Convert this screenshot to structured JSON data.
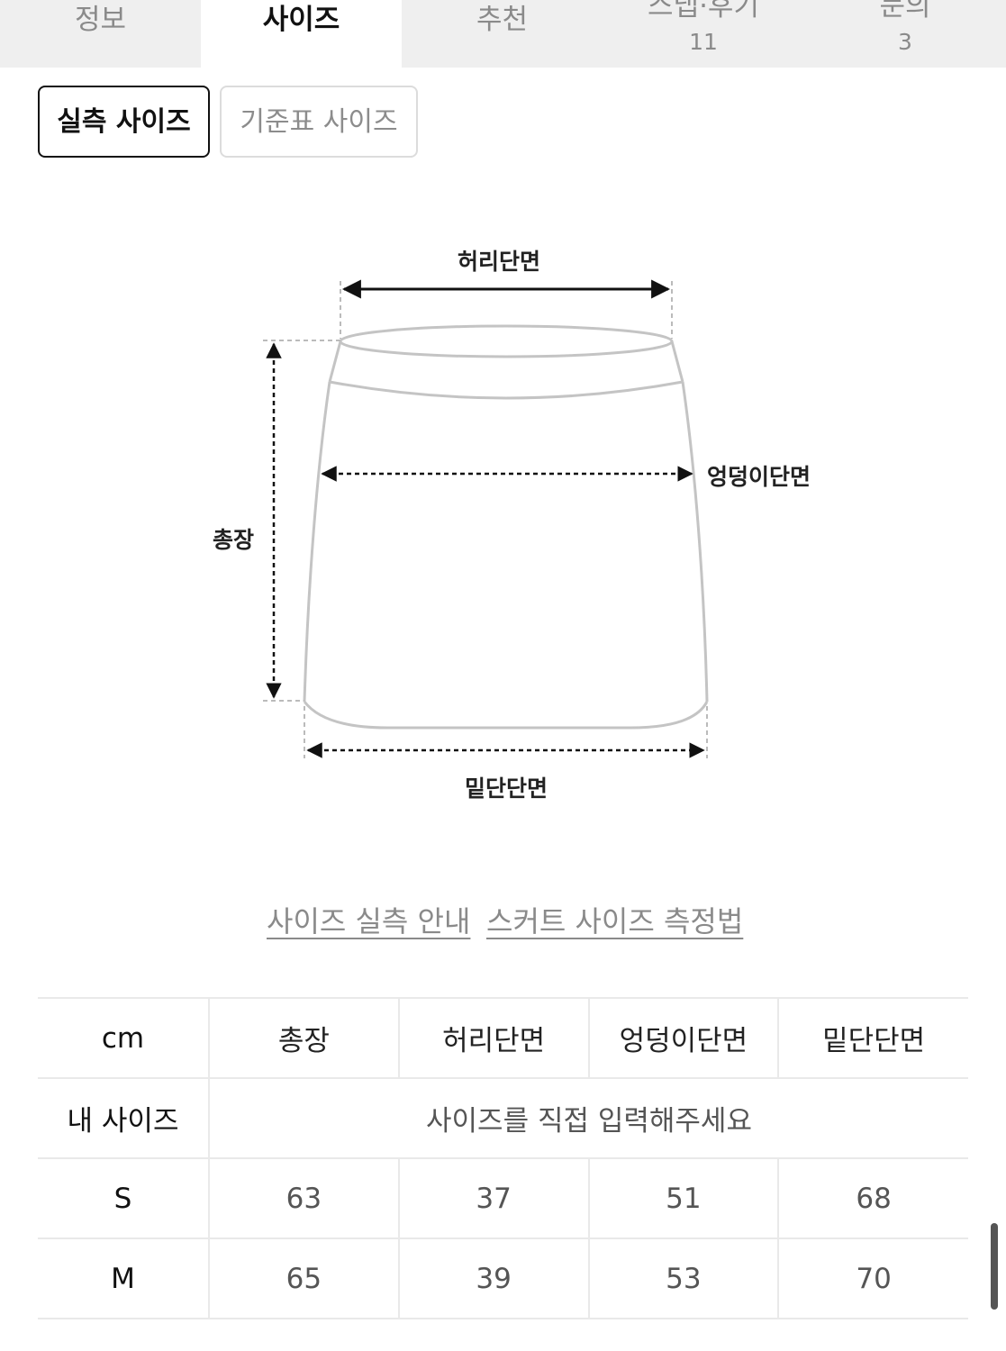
{
  "tabs": [
    {
      "label": "정보",
      "count": null,
      "active": false
    },
    {
      "label": "사이즈",
      "count": null,
      "active": true
    },
    {
      "label": "추천",
      "count": null,
      "active": false
    },
    {
      "label": "스냅·후기",
      "count": "11",
      "active": false
    },
    {
      "label": "문의",
      "count": "3",
      "active": false
    }
  ],
  "segments": {
    "measured": "실측 사이즈",
    "standard": "기준표 사이즈"
  },
  "diagram": {
    "waist": "허리단면",
    "hip": "엉덩이단면",
    "length": "총장",
    "hem": "밑단단면"
  },
  "links": {
    "guide": "사이즈 실측 안내",
    "method": "스커트 사이즈 측정법"
  },
  "table": {
    "unit": "cm",
    "headers": [
      "총장",
      "허리단면",
      "엉덩이단면",
      "밑단단면"
    ],
    "my_size_label": "내 사이즈",
    "my_size_placeholder": "사이즈를 직접 입력해주세요",
    "rows": [
      {
        "size": "S",
        "values": [
          "63",
          "37",
          "51",
          "68"
        ]
      },
      {
        "size": "M",
        "values": [
          "65",
          "39",
          "53",
          "70"
        ]
      }
    ]
  },
  "colors": {
    "text": "#111111",
    "muted": "#8a8a8a",
    "tabbar_bg": "#efefef",
    "border": "#e9e9e9",
    "outline": "#bdbdbd"
  }
}
